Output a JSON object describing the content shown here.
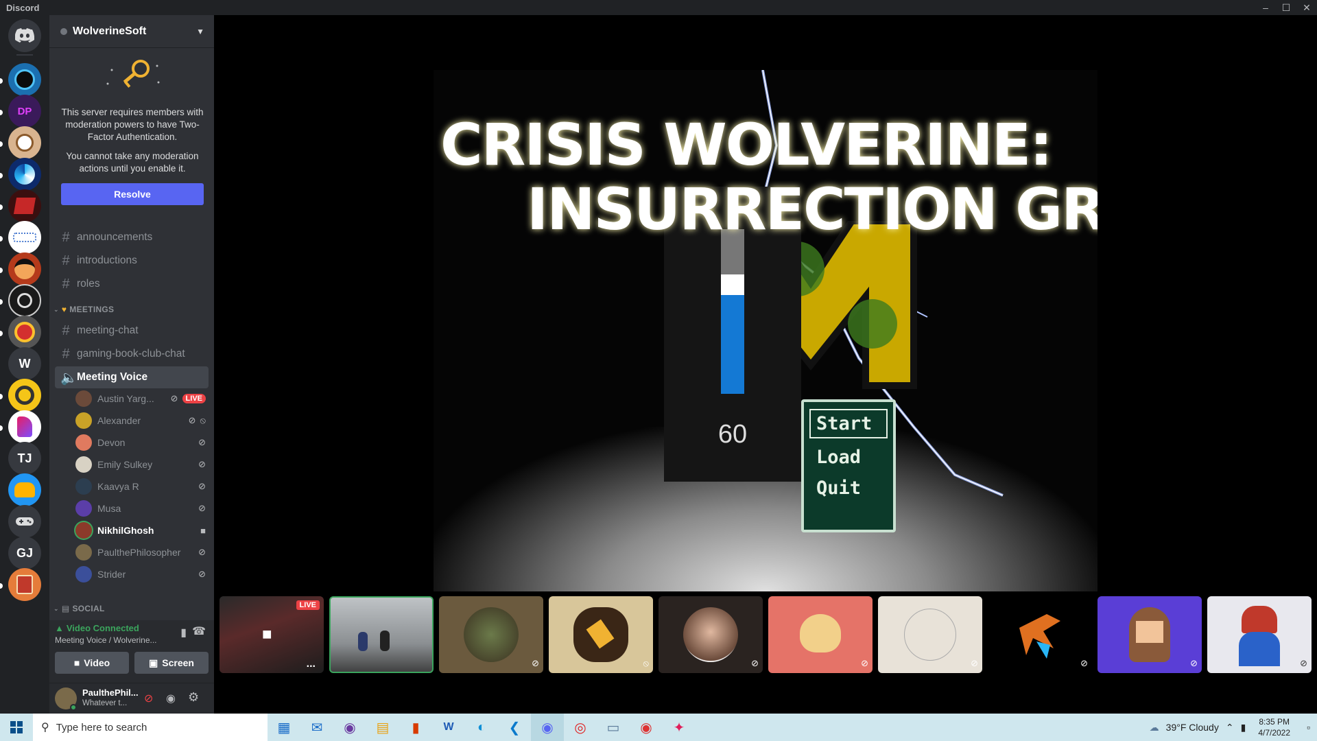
{
  "window": {
    "app_title": "Discord",
    "controls": [
      "–",
      "☐",
      "✕"
    ]
  },
  "guilds": {
    "user_initials": [
      "W",
      "TJ",
      "GJ"
    ]
  },
  "server": {
    "name": "WolverineSoft",
    "tfa_text": "This server requires members with moderation powers to have Two-Factor Authentication.",
    "tfa_text2": "You cannot take any moderation actions until you enable it.",
    "resolve_label": "Resolve"
  },
  "channels": {
    "top": [
      "announcements",
      "introductions",
      "roles"
    ],
    "meetings_label": "MEETINGS",
    "meetings": [
      "meeting-chat",
      "gaming-book-club-chat"
    ],
    "voice_channel": "Meeting Voice",
    "social_label": "SOCIAL"
  },
  "voice_users": [
    {
      "name": "Austin Yarg...",
      "badge": "LIVE",
      "color": "#6b4a3a"
    },
    {
      "name": "Alexander",
      "color": "#c9a227"
    },
    {
      "name": "Devon",
      "color": "#e07a5f"
    },
    {
      "name": "Emily Sulkey",
      "color": "#d8d2c4"
    },
    {
      "name": "Kaavya R",
      "color": "#2c3e50"
    },
    {
      "name": "Musa",
      "color": "#5b3ea8"
    },
    {
      "name": "NikhilGhosh",
      "color": "#8b3a2a"
    },
    {
      "name": "PaulthePhilosopher",
      "color": "#7a6a4a"
    },
    {
      "name": "Strider",
      "color": "#3b4f9a"
    }
  ],
  "voice_panel": {
    "status": "Video Connected",
    "channel": "Meeting Voice / Wolverine...",
    "video_label": "Video",
    "screen_label": "Screen"
  },
  "user": {
    "name": "PaulthePhil...",
    "status": "Whatever t..."
  },
  "stream": {
    "title_line1": "CRISIS WOLVERINE:",
    "title_line2": "INSURRECTION GREEN",
    "volume_value": "60",
    "volume_fraction": 0.6,
    "menu": [
      "Start",
      "Load",
      "Quit"
    ]
  },
  "tiles": {
    "live_label": "LIVE",
    "overflow": "..."
  },
  "taskbar": {
    "search_placeholder": "Type here to search",
    "weather": "39°F  Cloudy",
    "time": "8:35 PM",
    "date": "4/7/2022"
  },
  "colors": {
    "blurple": "#5865f2",
    "live_red": "#ed4245",
    "green": "#3ba55d"
  }
}
